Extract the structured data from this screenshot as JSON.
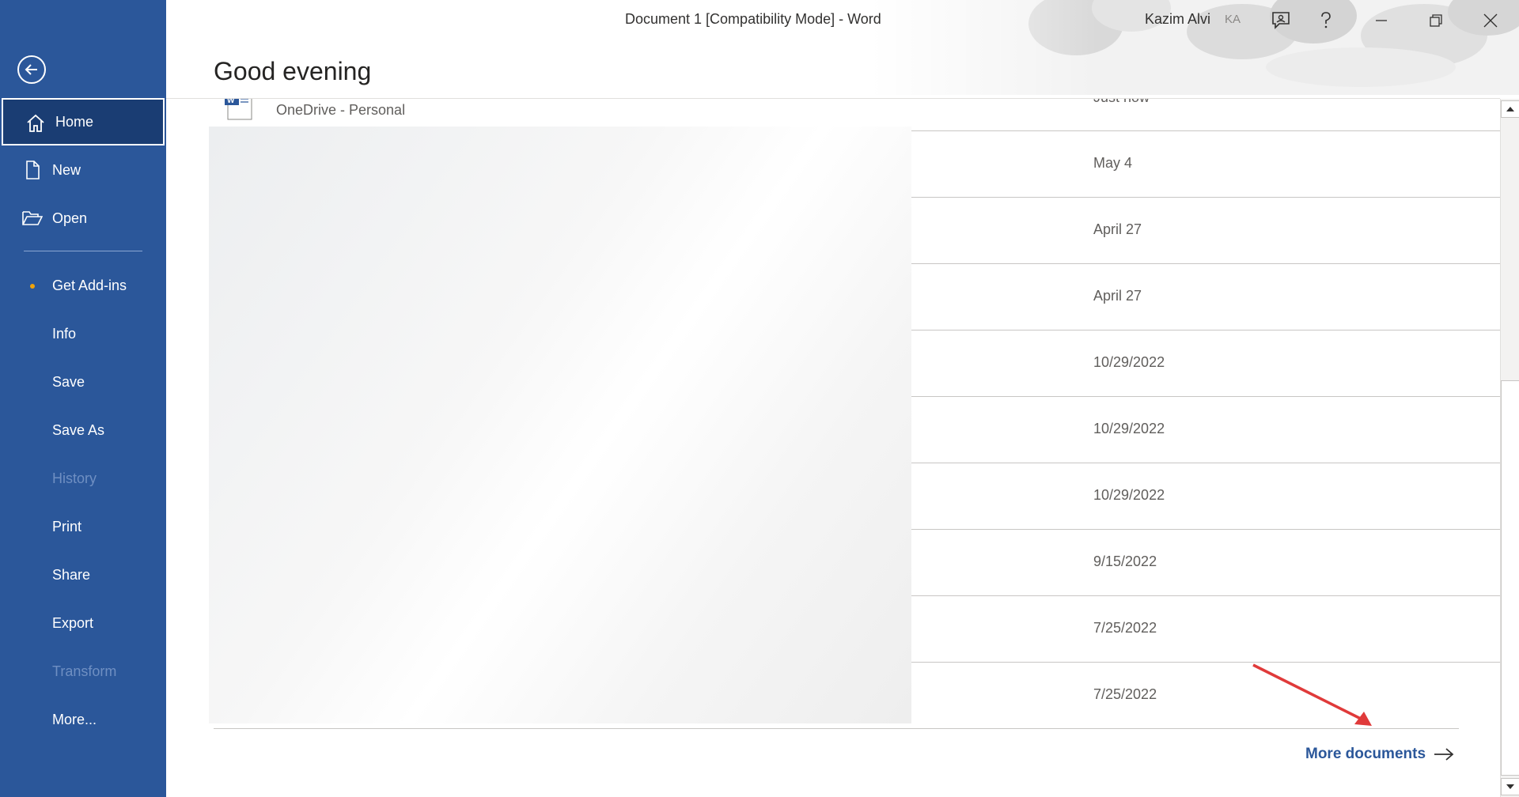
{
  "window": {
    "title": "Document 1 [Compatibility Mode]  -  Word",
    "user_name": "Kazim Alvi",
    "user_initials": "KA"
  },
  "sidebar": {
    "items": [
      {
        "label": "Home",
        "icon": "home-icon",
        "active": true
      },
      {
        "label": "New",
        "icon": "new-document-icon"
      },
      {
        "label": "Open",
        "icon": "folder-open-icon"
      },
      {
        "label": "Get Add-ins",
        "icon": "notification-dot"
      },
      {
        "label": "Info"
      },
      {
        "label": "Save"
      },
      {
        "label": "Save As"
      },
      {
        "label": "History",
        "disabled": true
      },
      {
        "label": "Print"
      },
      {
        "label": "Share"
      },
      {
        "label": "Export"
      },
      {
        "label": "Transform",
        "disabled": true
      },
      {
        "label": "More..."
      }
    ]
  },
  "main": {
    "greeting": "Good evening",
    "top_row": {
      "location": "OneDrive - Personal",
      "date": "Just now"
    },
    "dates": [
      "May 4",
      "April 27",
      "April 27",
      "10/29/2022",
      "10/29/2022",
      "10/29/2022",
      "9/15/2022",
      "7/25/2022",
      "7/25/2022"
    ],
    "more_documents": "More documents"
  },
  "colors": {
    "sidebar": "#2b579a",
    "sidebar_active": "#1a3d73",
    "accent_link": "#2b579a",
    "annotation_arrow": "#e03a3a",
    "addins_dot": "#f0a30a"
  }
}
